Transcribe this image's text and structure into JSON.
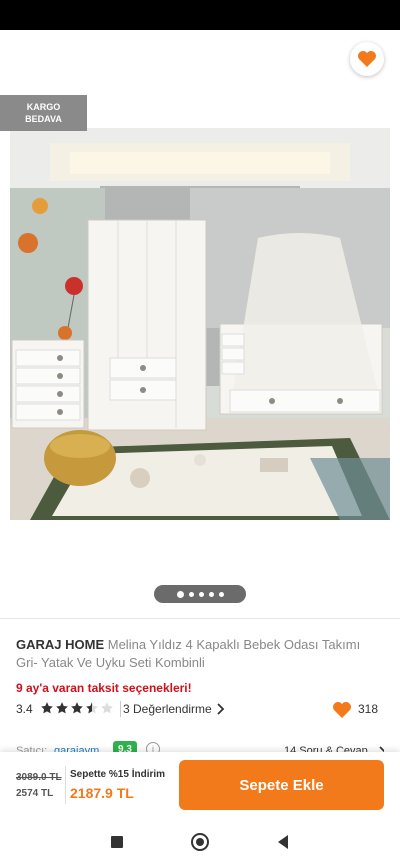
{
  "badge": {
    "line1": "KARGO",
    "line2": "BEDAVA"
  },
  "product": {
    "brand": "GARAJ HOME",
    "name": "Melina Yıldız 4 Kapaklı Bebek Odası Takımı Gri- Yatak Ve Uyku Seti Kombinli",
    "installment_text": "9 ay'a varan taksit seçenekleri!"
  },
  "rating": {
    "value": "3.4",
    "stars_filled": 3.4,
    "reviews_label": "3 Değerlendirme",
    "like_count": "318"
  },
  "seller": {
    "label": "Satıcı:",
    "name": "garajaym",
    "score": "9.3",
    "info_icon": "i",
    "qa_label": "14 Soru & Cevap"
  },
  "gallery": {
    "image_count": 5,
    "active_index": 0
  },
  "pricing": {
    "original_price": "3089.0 TL",
    "discounted_price": "2574 TL",
    "promo_label": "Sepette %15 İndirim",
    "final_price": "2187.9 TL"
  },
  "cart_button": {
    "label": "Sepete Ekle"
  },
  "icons": {
    "back": "arrow-left-icon",
    "share": "share-icon",
    "favorite": "heart-icon",
    "star": "star-icon",
    "chevron": "chevron-right-icon"
  },
  "colors": {
    "accent": "#f27a1a",
    "discount_red": "#d0101b",
    "seller_link": "#1c7ec5",
    "seller_score": "#2fb24c",
    "badge_gray": "#8a8a8a"
  }
}
